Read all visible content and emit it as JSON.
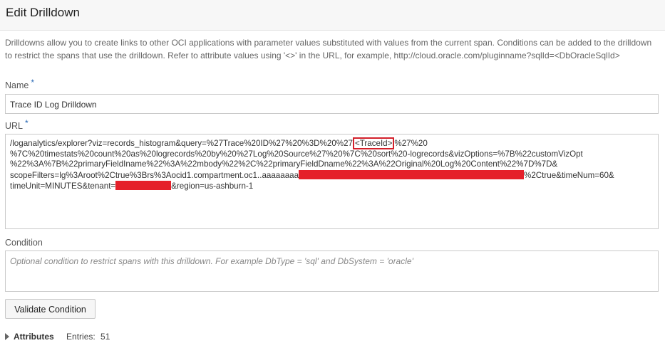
{
  "page": {
    "title": "Edit Drilldown",
    "description": "Drilldowns allow you to create links to other OCI applications with parameter values substituted with values from the current span. Conditions can be added to the drilldown to restrict the spans that use the drilldown. Refer to attribute values using '<>' in the URL, for example, http://cloud.oracle.com/pluginname?sqlId=<DbOracleSqlId>"
  },
  "name_field": {
    "label": "Name",
    "required_mark": "*",
    "value": "Trace ID Log Drilldown"
  },
  "url_field": {
    "label": "URL",
    "required_mark": "*",
    "line1_pre": "/loganalytics/explorer?viz=records_histogram&query=%27Trace%20ID%27%20%3D%20%27",
    "line1_trace": "<TraceId>",
    "line1_post": "%27%20",
    "line2": "%7C%20timestats%20count%20as%20logrecords%20by%20%27Log%20Source%27%20%7C%20sort%20-logrecords&vizOptions=%7B%22customVizOpt",
    "line3": "%22%3A%7B%22primaryFieldIname%22%3A%22mbody%22%2C%22primaryFieldDname%22%3A%22Original%20Log%20Content%22%7D%7D&",
    "line4_pre": "scopeFilters=lg%3Aroot%2Ctrue%3Brs%3Aocid1.compartment.oc1..aaaaaaaa",
    "line4_post": "%2Ctrue&timeNum=60&",
    "line5_pre": "timeUnit=MINUTES&tenant=",
    "line5_post": "&region=us-ashburn-1"
  },
  "condition_field": {
    "label": "Condition",
    "placeholder": "Optional condition to restrict spans with this drilldown. For example DbType = 'sql' and DbSystem = 'oracle'"
  },
  "validate_button": {
    "label": "Validate Condition"
  },
  "attributes": {
    "label": "Attributes",
    "entries_label": "Entries:",
    "entries_count": "51"
  },
  "colors": {
    "redaction": "#e5202a",
    "highlight_box": "#d3202a",
    "required_mark": "#2a6ab6"
  }
}
